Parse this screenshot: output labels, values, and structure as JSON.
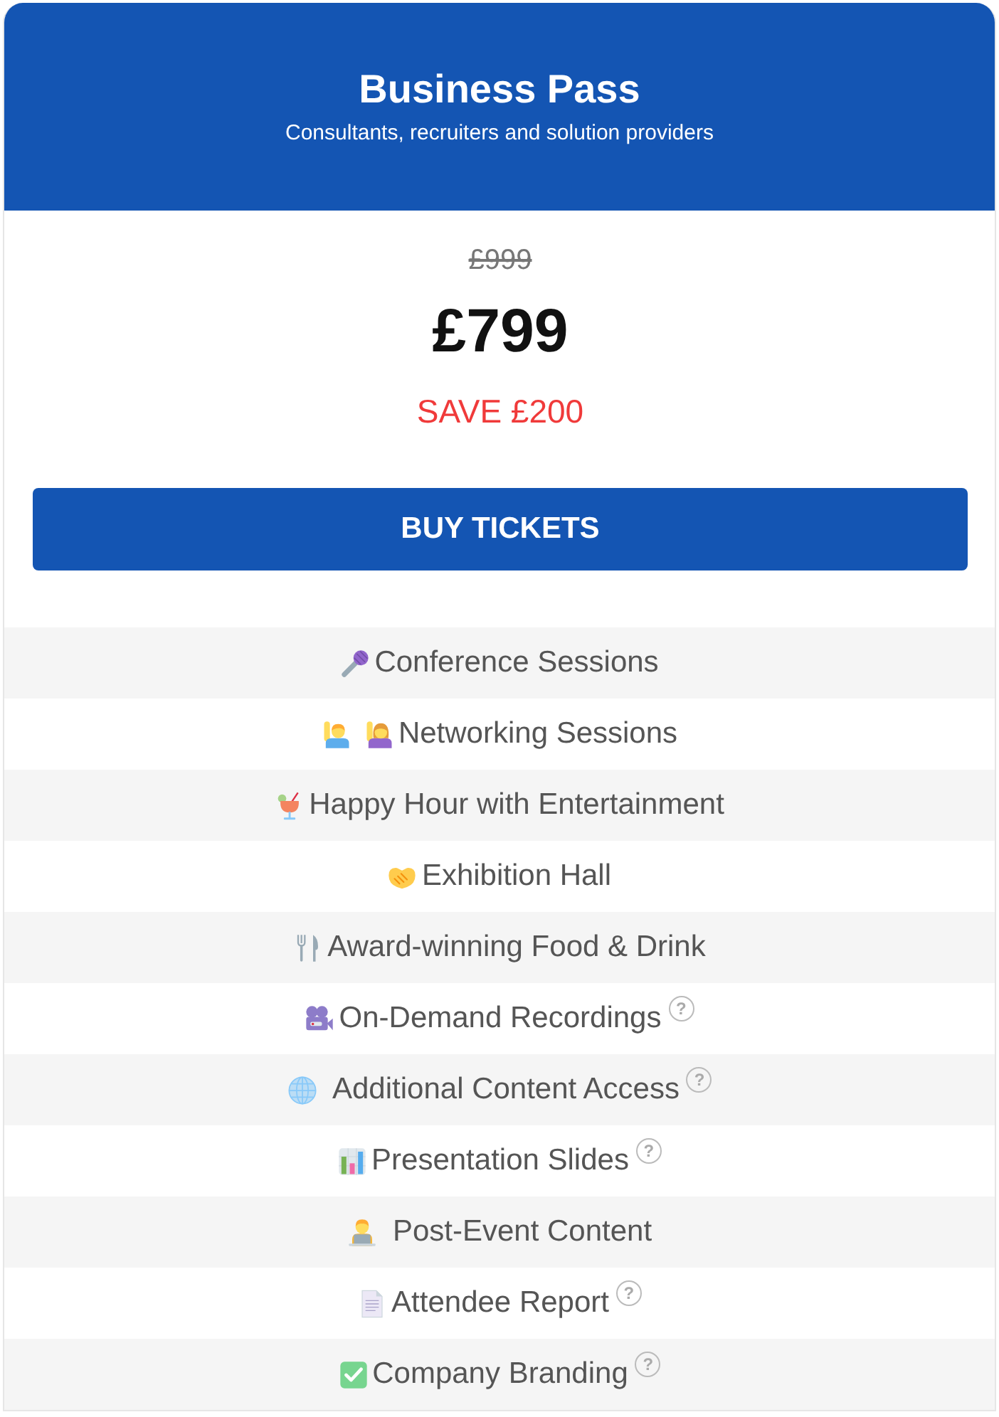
{
  "header": {
    "title": "Business Pass",
    "subtitle": "Consultants, recruiters and solution providers"
  },
  "pricing": {
    "original_price": "£999",
    "price": "£799",
    "savings": "SAVE £200"
  },
  "button": {
    "label": "BUY TICKETS"
  },
  "features": [
    {
      "label": "Conference Sessions"
    },
    {
      "label": "Networking Sessions"
    },
    {
      "label": "Happy Hour with Entertainment"
    },
    {
      "label": "Exhibition Hall"
    },
    {
      "label": "Award-winning Food & Drink"
    },
    {
      "label": "On-Demand Recordings",
      "help": "?"
    },
    {
      "label": "Additional Content Access",
      "help": "?"
    },
    {
      "label": "Presentation Slides",
      "help": "?"
    },
    {
      "label": "Post-Event Content"
    },
    {
      "label": "Attendee Report",
      "help": "?"
    },
    {
      "label": "Company Branding",
      "help": "?"
    }
  ]
}
